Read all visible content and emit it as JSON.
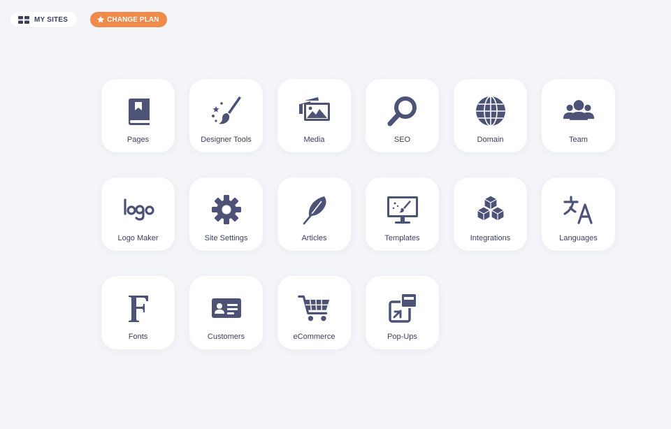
{
  "colors": {
    "background": "#f4f5f9",
    "tile": "#ffffff",
    "icon": "#4d5377",
    "text": "#3b3f5c",
    "accent": "#f08a4b"
  },
  "topbar": {
    "my_sites": {
      "label": "MY SITES",
      "icon": "grid-icon"
    },
    "change_plan": {
      "label": "CHANGE PLAN",
      "icon": "star-icon"
    }
  },
  "tiles": [
    {
      "label": "Pages",
      "icon": "book-icon"
    },
    {
      "label": "Designer Tools",
      "icon": "paintbrush-icon"
    },
    {
      "label": "Media",
      "icon": "images-icon"
    },
    {
      "label": "SEO",
      "icon": "search-icon"
    },
    {
      "label": "Domain",
      "icon": "globe-icon"
    },
    {
      "label": "Team",
      "icon": "users-icon"
    },
    {
      "label": "Logo Maker",
      "icon": "logo-icon"
    },
    {
      "label": "Site Settings",
      "icon": "gear-icon"
    },
    {
      "label": "Articles",
      "icon": "feather-icon"
    },
    {
      "label": "Templates",
      "icon": "monitor-icon"
    },
    {
      "label": "Integrations",
      "icon": "cubes-icon"
    },
    {
      "label": "Languages",
      "icon": "translate-icon"
    },
    {
      "label": "Fonts",
      "icon": "font-icon"
    },
    {
      "label": "Customers",
      "icon": "id-card-icon"
    },
    {
      "label": "eCommerce",
      "icon": "cart-icon"
    },
    {
      "label": "Pop-Ups",
      "icon": "popup-icon"
    }
  ]
}
